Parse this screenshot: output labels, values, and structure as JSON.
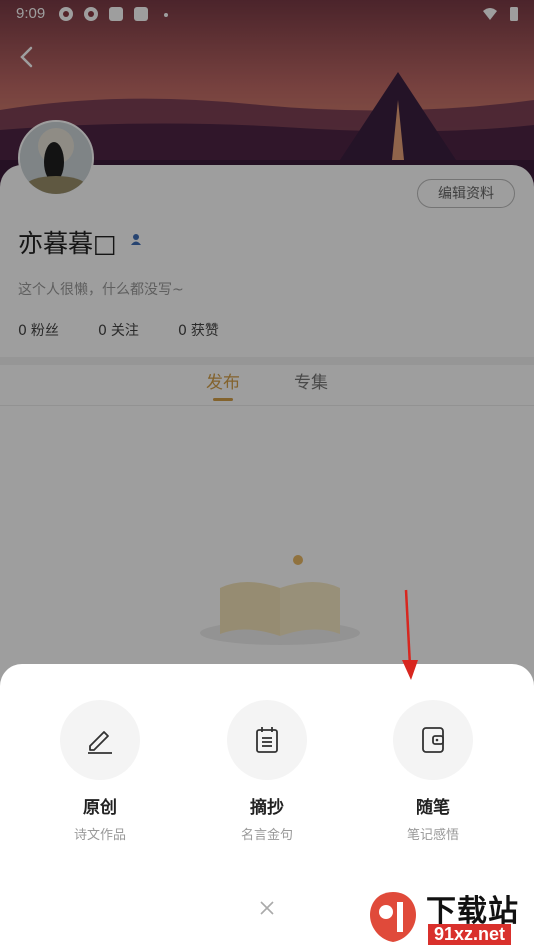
{
  "status_bar": {
    "time": "9:09"
  },
  "profile": {
    "name": "亦暮暮□",
    "bio": "这个人很懒，什么都没写~",
    "edit_label": "编辑资料",
    "stats": [
      {
        "num": "0",
        "label": "粉丝"
      },
      {
        "num": "0",
        "label": "关注"
      },
      {
        "num": "0",
        "label": "获赞"
      }
    ]
  },
  "tabs": [
    {
      "label": "发布"
    },
    {
      "label": "专集"
    }
  ],
  "sheet": {
    "options": [
      {
        "title": "原创",
        "subtitle": "诗文作品",
        "icon": "pencil-icon"
      },
      {
        "title": "摘抄",
        "subtitle": "名言金句",
        "icon": "clipboard-icon"
      },
      {
        "title": "随笔",
        "subtitle": "笔记感悟",
        "icon": "notebook-icon"
      }
    ]
  },
  "watermark": {
    "title": "下载站",
    "url": "91xz.net"
  },
  "colors": {
    "accent": "#d4a04a",
    "arrow": "#d8261f"
  }
}
